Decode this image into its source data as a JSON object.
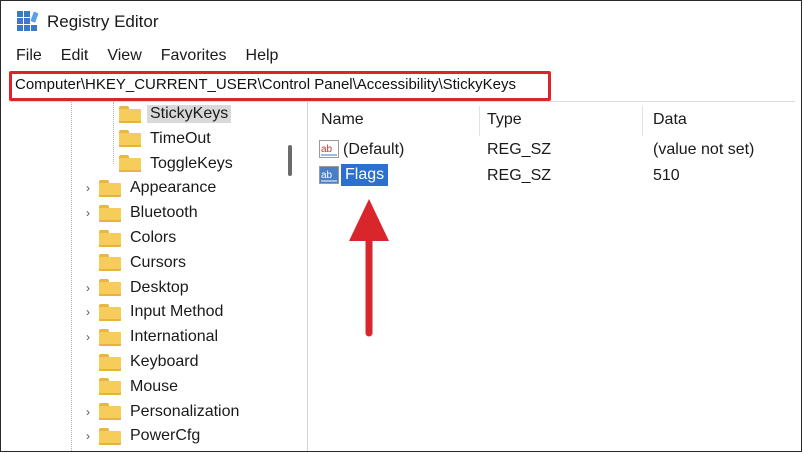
{
  "window": {
    "title": "Registry Editor",
    "icon": "registry-editor-icon"
  },
  "menu": [
    "File",
    "Edit",
    "View",
    "Favorites",
    "Help"
  ],
  "address": {
    "path": "Computer\\HKEY_CURRENT_USER\\Control Panel\\Accessibility\\StickyKeys",
    "highlight_color": "#d9262c"
  },
  "tree": {
    "items": [
      {
        "label": "StickyKeys",
        "expandable": false,
        "selected": true
      },
      {
        "label": "TimeOut",
        "expandable": false,
        "selected": false
      },
      {
        "label": "ToggleKeys",
        "expandable": false,
        "selected": false
      },
      {
        "label": "Appearance",
        "expandable": true,
        "selected": false
      },
      {
        "label": "Bluetooth",
        "expandable": true,
        "selected": false
      },
      {
        "label": "Colors",
        "expandable": false,
        "selected": false
      },
      {
        "label": "Cursors",
        "expandable": false,
        "selected": false
      },
      {
        "label": "Desktop",
        "expandable": true,
        "selected": false
      },
      {
        "label": "Input Method",
        "expandable": true,
        "selected": false
      },
      {
        "label": "International",
        "expandable": true,
        "selected": false
      },
      {
        "label": "Keyboard",
        "expandable": false,
        "selected": false
      },
      {
        "label": "Mouse",
        "expandable": false,
        "selected": false
      },
      {
        "label": "Personalization",
        "expandable": true,
        "selected": false
      },
      {
        "label": "PowerCfg",
        "expandable": true,
        "selected": false
      }
    ]
  },
  "list": {
    "columns": [
      "Name",
      "Type",
      "Data"
    ],
    "rows": [
      {
        "name": "(Default)",
        "type": "REG_SZ",
        "data": "(value not set)",
        "icon": "string-value-icon",
        "selected": false
      },
      {
        "name": "Flags",
        "type": "REG_SZ",
        "data": "510",
        "icon": "string-value-icon",
        "selected": true
      }
    ],
    "selection_color": "#2b6fd1"
  },
  "annotation": {
    "arrow_color": "#d9262c",
    "icon": "up-arrow-icon"
  }
}
